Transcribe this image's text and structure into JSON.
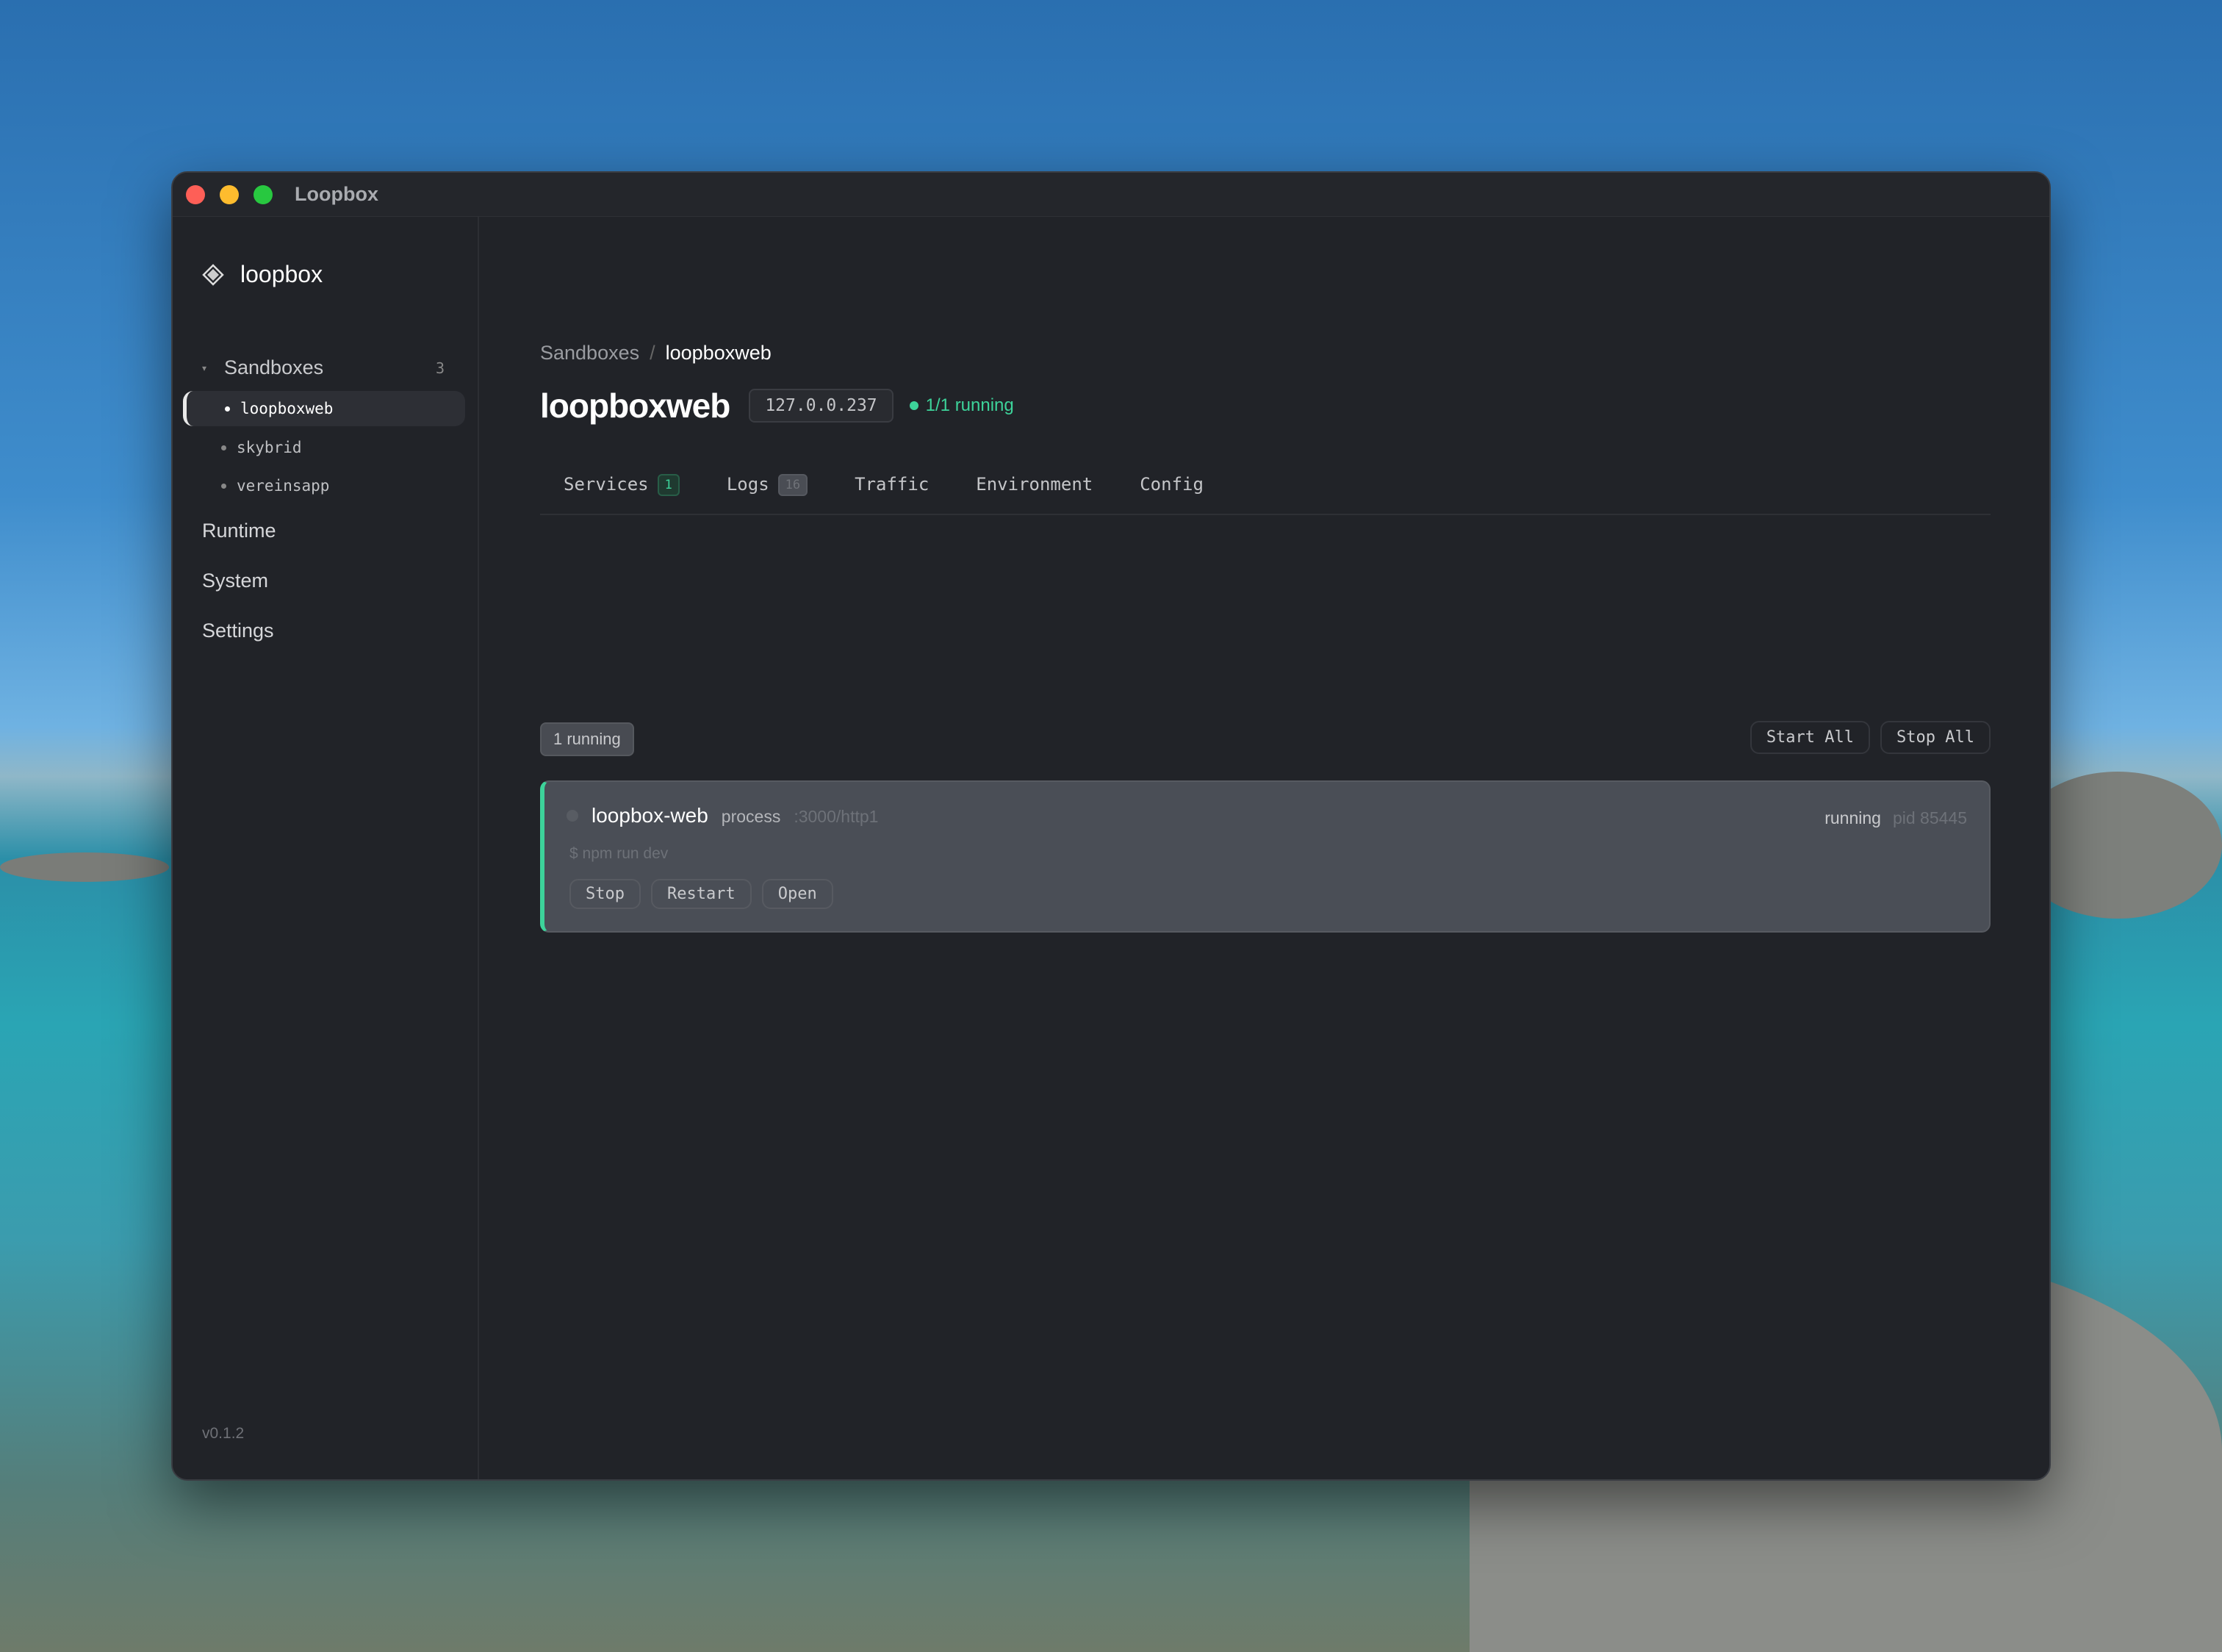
{
  "window": {
    "title": "Loopbox"
  },
  "sidebar": {
    "logo": "loopbox",
    "sandboxes": {
      "label": "Sandboxes",
      "count": "3",
      "items": [
        {
          "label": "loopboxweb",
          "active": true
        },
        {
          "label": "skybrid"
        },
        {
          "label": "vereinsapp"
        }
      ]
    },
    "sections": [
      {
        "label": "Runtime"
      },
      {
        "label": "System"
      },
      {
        "label": "Settings"
      }
    ],
    "version": "v0.1.2"
  },
  "main": {
    "breadcrumb": {
      "parent": "Sandboxes",
      "separator": "/",
      "current": "loopboxweb"
    },
    "title": "loopboxweb",
    "ip": "127.0.0.237",
    "status": "1/1 running",
    "tabs": [
      {
        "label": "Services",
        "badge": "1"
      },
      {
        "label": "Logs",
        "badge": "16"
      },
      {
        "label": "Traffic"
      },
      {
        "label": "Environment"
      },
      {
        "label": "Config"
      }
    ],
    "filter_chip": "1 running",
    "actions": {
      "start_all": "Start All",
      "stop_all": "Stop All"
    },
    "service": {
      "name": "loopbox-web",
      "type": "process",
      "port": ":3000/http1",
      "state": "running",
      "pid": "pid 85445",
      "command": "$ npm run dev",
      "buttons": {
        "stop": "Stop",
        "restart": "Restart",
        "open": "Open"
      }
    }
  },
  "colors": {
    "accent": "#3dd39a",
    "bg": "#212328",
    "card": "#4a4e56"
  }
}
